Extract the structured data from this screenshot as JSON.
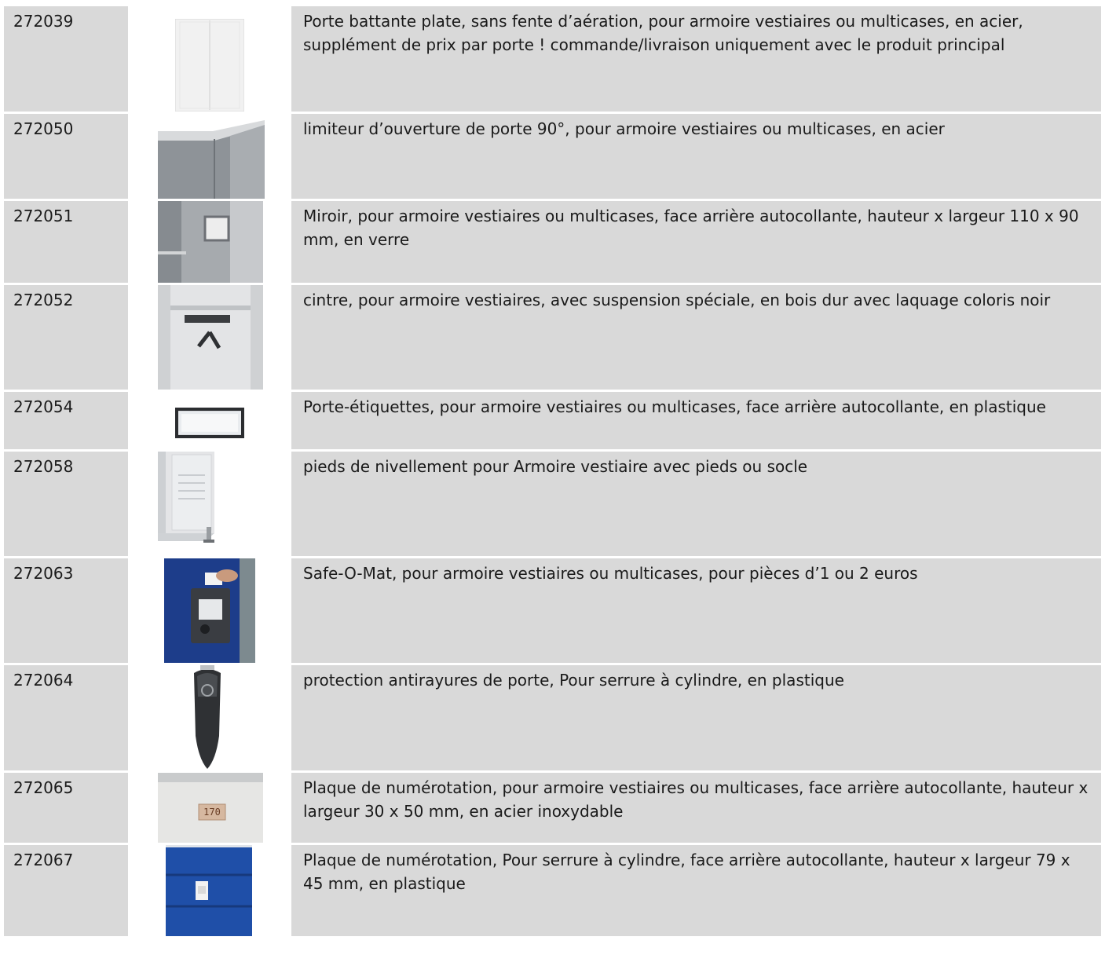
{
  "rows": [
    {
      "code": "272039",
      "description": "Porte battante plate, sans fente d’aération, pour armoire vestiaires ou multicases, en acier, supplément de prix par porte ! commande/livraison uniquement avec le produit principal",
      "image": "locker-door-photo"
    },
    {
      "code": "272050",
      "description": "limiteur d’ouverture de porte 90°, pour armoire vestiaires ou multicases, en acier",
      "image": "door-limiter-photo"
    },
    {
      "code": "272051",
      "description": "Miroir, pour armoire vestiaires ou multicases, face arrière autocollante, hauteur x largeur 110 x 90 mm, en verre",
      "image": "mirror-photo"
    },
    {
      "code": "272052",
      "description": "cintre, pour armoire vestiaires, avec suspension spéciale, en bois dur avec laquage coloris noir",
      "image": "hanger-photo"
    },
    {
      "code": "272054",
      "description": "Porte-étiquettes, pour armoire vestiaires ou multicases, face arrière autocollante, en plastique",
      "image": "label-holder-photo"
    },
    {
      "code": "272058",
      "description": "pieds de nivellement pour Armoire vestiaire avec pieds ou socle",
      "image": "leveling-feet-photo"
    },
    {
      "code": "272063",
      "description": "Safe-O-Mat, pour armoire vestiaires ou multicases, pour pièces d’1 ou 2 euros",
      "image": "coin-lock-photo"
    },
    {
      "code": "272064",
      "description": "protection antirayures de porte, Pour serrure à cylindre, en plastique",
      "image": "scratch-guard-photo"
    },
    {
      "code": "272065",
      "description": "Plaque de numérotation, pour armoire vestiaires ou multicases, face arrière autocollante, hauteur x largeur 30 x 50 mm, en acier inoxydable",
      "image": "number-plate-photo",
      "plate_text": "170"
    },
    {
      "code": "272067",
      "description": "Plaque de numérotation, Pour serrure à cylindre, face arrière autocollante, hauteur x largeur 79 x 45 mm, en plastique",
      "image": "cylinder-number-plate-photo"
    }
  ]
}
